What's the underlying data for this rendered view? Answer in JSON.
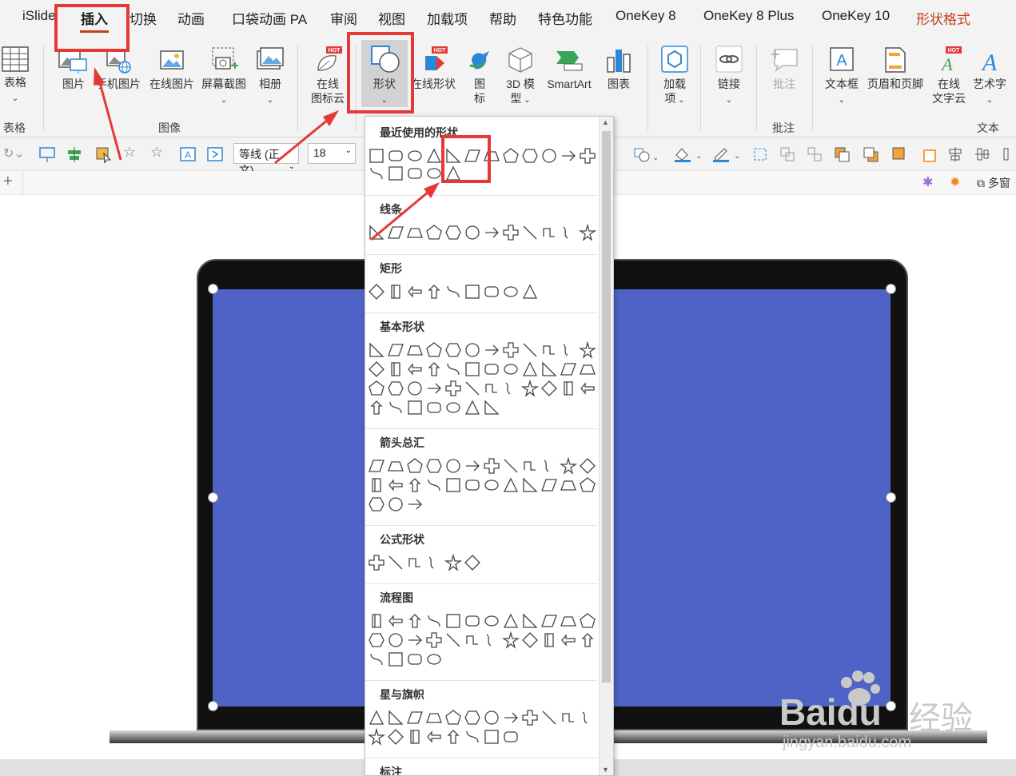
{
  "tabs": [
    {
      "label": "iSlide"
    },
    {
      "label": "插入"
    },
    {
      "label": "切换"
    },
    {
      "label": "动画"
    },
    {
      "label": "口袋动画 PA"
    },
    {
      "label": "审阅"
    },
    {
      "label": "视图"
    },
    {
      "label": "加载项"
    },
    {
      "label": "帮助"
    },
    {
      "label": "特色功能"
    },
    {
      "label": "OneKey 8"
    },
    {
      "label": "OneKey 8 Plus"
    },
    {
      "label": "OneKey 10"
    },
    {
      "label": "形状格式"
    }
  ],
  "ribbon": {
    "table": {
      "label": "表格",
      "group": "表格"
    },
    "picture": {
      "label": "图片"
    },
    "phone_picture": {
      "label": "手机图片"
    },
    "online_picture": {
      "label": "在线图片"
    },
    "screenshot": {
      "label": "屏幕截图"
    },
    "album": {
      "label": "相册"
    },
    "image_group": "图像",
    "online_icon_cloud": {
      "line1": "在线",
      "line2": "图标云",
      "badge": "HOT"
    },
    "shapes": {
      "label": "形状"
    },
    "online_shapes": {
      "label": "在线形状",
      "badge": "HOT"
    },
    "icons": {
      "line1": "图",
      "line2": "标"
    },
    "model3d": {
      "line1": "3D 模",
      "line2": "型"
    },
    "smartart": {
      "label": "SmartArt"
    },
    "chart": {
      "label": "图表"
    },
    "addins": {
      "line1": "加载",
      "line2": "项"
    },
    "link": {
      "label": "链接"
    },
    "comment": {
      "label": "批注",
      "group": "批注"
    },
    "textbox": {
      "label": "文本框"
    },
    "header_footer": {
      "label": "页眉和页脚"
    },
    "online_text_cloud": {
      "line1": "在线",
      "line2": "文字云",
      "badge": "HOT"
    },
    "wordart": {
      "label": "艺术字"
    },
    "text_group": "文本"
  },
  "toolbar2": {
    "font_name": "等线 (正文)",
    "font_size": "18"
  },
  "toolbar3": {
    "right_label": "多窗"
  },
  "shapes_menu": {
    "sections": [
      {
        "title": "最近使用的形状"
      },
      {
        "title": "线条"
      },
      {
        "title": "矩形"
      },
      {
        "title": "基本形状"
      },
      {
        "title": "箭头总汇"
      },
      {
        "title": "公式形状"
      },
      {
        "title": "流程图"
      },
      {
        "title": "星与旗帜"
      },
      {
        "title": "标注"
      }
    ]
  },
  "watermark": {
    "brand": "Baidu",
    "cn": "经验",
    "url": "jingyan.baidu.com"
  },
  "colors": {
    "accent_red": "#e53935",
    "screen_blue": "#4f63c6",
    "ribbon_bg": "#f3f3f3",
    "tab_accent": "#c43e1c"
  }
}
